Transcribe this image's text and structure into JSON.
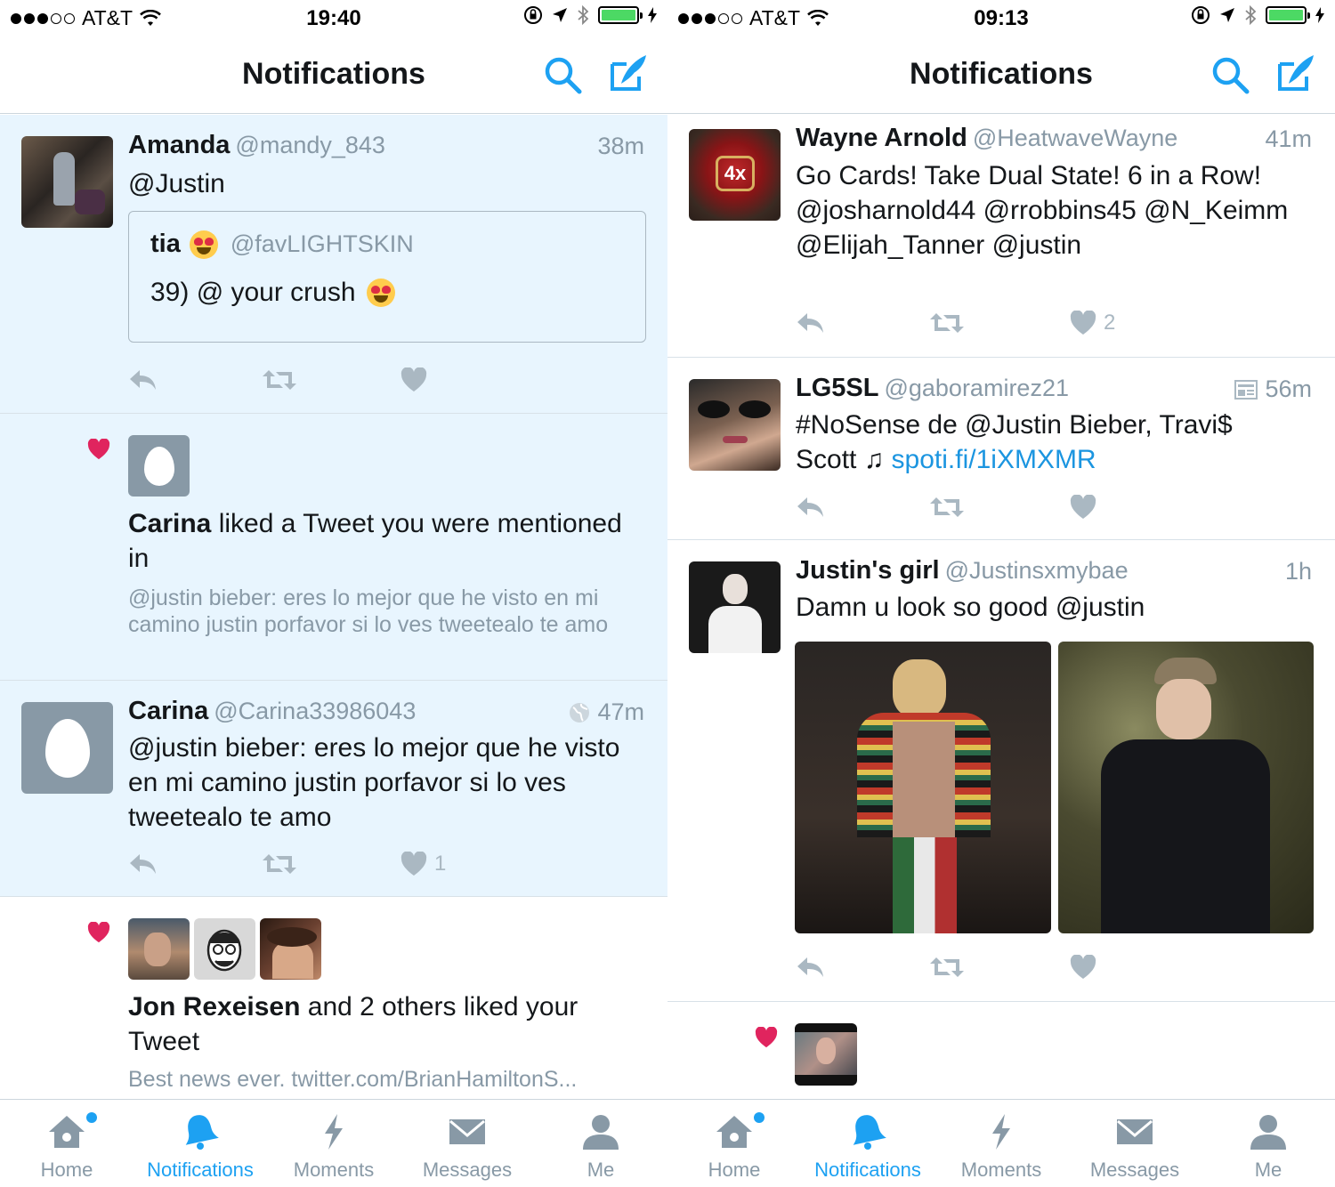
{
  "left": {
    "status": {
      "carrier": "AT&T",
      "time": "19:40"
    },
    "nav_title": "Notifications",
    "tweet_amanda": {
      "name": "Amanda",
      "handle": "@mandy_843",
      "time": "38m",
      "text": "@Justin",
      "quote": {
        "name": "tia",
        "handle": "@favLIGHTSKIN",
        "text": "39) @ your crush"
      }
    },
    "like_carina": {
      "actor": "Carina",
      "action": " liked a Tweet you were mentioned in",
      "snippet": "@justin bieber: eres lo mejor que he visto en mi camino justin porfavor si lo ves tweetealo te amo"
    },
    "tweet_carina": {
      "name": "Carina",
      "handle": "@Carina33986043",
      "time": "47m",
      "text": "@justin bieber: eres lo mejor que he visto en mi camino justin porfavor si lo ves tweetealo te amo",
      "like_count": "1"
    },
    "like_jon": {
      "actor": "Jon Rexeisen",
      "action": " and 2 others liked your Tweet",
      "snippet": "Best news ever. twitter.com/BrianHamiltonS..."
    }
  },
  "right": {
    "status": {
      "carrier": "AT&T",
      "time": "09:13"
    },
    "nav_title": "Notifications",
    "tweet_wayne": {
      "name": "Wayne Arnold",
      "handle": "@HeatwaveWayne",
      "time": "41m",
      "text": "Go Cards! Take Dual State! 6 in a Row! @josharnold44 @rrobbins45 @N_Keimm @Elijah_Tanner @justin",
      "like_count": "2"
    },
    "tweet_lg5sl": {
      "name": "LG5SL",
      "handle": "@gaboramirez21",
      "time": "56m",
      "text": "#NoSense de @Justin Bieber, Travi$ Scott ♫",
      "link": "spoti.fi/1iXMXMR"
    },
    "tweet_justinsgirl": {
      "name": "Justin's girl",
      "handle": "@Justinsxmybae",
      "time": "1h",
      "text": "Damn u look so good @justin"
    }
  },
  "tabs": [
    {
      "label": "Home",
      "icon": "home-icon"
    },
    {
      "label": "Notifications",
      "icon": "bell-icon"
    },
    {
      "label": "Moments",
      "icon": "lightning-icon"
    },
    {
      "label": "Messages",
      "icon": "envelope-icon"
    },
    {
      "label": "Me",
      "icon": "person-icon"
    }
  ],
  "colors": {
    "accent": "#1da1f2",
    "highlight_bg": "#e8f5fe",
    "muted": "#8899a6",
    "like": "#e0245e"
  }
}
